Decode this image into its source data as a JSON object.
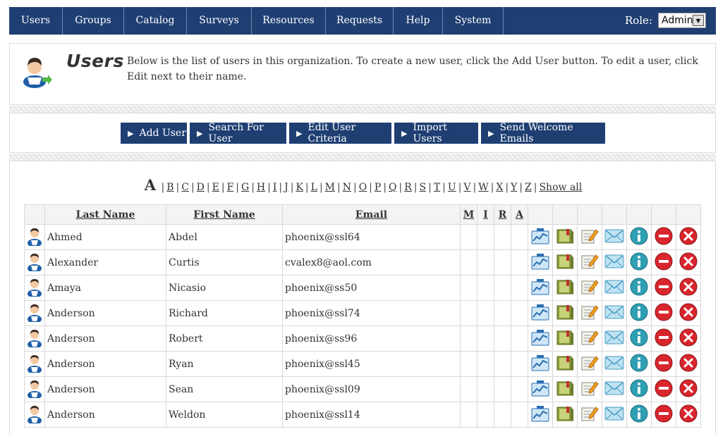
{
  "nav": {
    "items": [
      "Users",
      "Groups",
      "Catalog",
      "Surveys",
      "Resources",
      "Requests",
      "Help",
      "System"
    ],
    "role_label": "Role:",
    "role_value": "Admin"
  },
  "header": {
    "title": "Users",
    "description": "Below is the list of users in this organization. To create a new user, click the Add User button. To edit a user, click Edit next to their name."
  },
  "actions": {
    "add_user": "Add User",
    "search_user": "Search For User",
    "edit_criteria": "Edit User Criteria",
    "import_users": "Import Users",
    "send_welcome": "Send Welcome Emails"
  },
  "letters": {
    "current": "A",
    "items": [
      "B",
      "C",
      "D",
      "E",
      "F",
      "G",
      "H",
      "I",
      "J",
      "K",
      "L",
      "M",
      "N",
      "O",
      "P",
      "Q",
      "R",
      "S",
      "T",
      "U",
      "V",
      "W",
      "X",
      "Y",
      "Z"
    ],
    "show_all": "Show all"
  },
  "table": {
    "headers": {
      "last": "Last Name",
      "first": "First Name",
      "email": "Email",
      "m": "M",
      "i": "I",
      "r": "R",
      "a": "A"
    },
    "rows": [
      {
        "last": "Ahmed",
        "first": "Abdel",
        "email": "phoenix@ssl64"
      },
      {
        "last": "Alexander",
        "first": "Curtis",
        "email": "cvalex8@aol.com"
      },
      {
        "last": "Amaya",
        "first": "Nicasio",
        "email": "phoenix@ss50"
      },
      {
        "last": "Anderson",
        "first": "Richard",
        "email": "phoenix@ssl74"
      },
      {
        "last": "Anderson",
        "first": "Robert",
        "email": "phoenix@ss96"
      },
      {
        "last": "Anderson",
        "first": "Ryan",
        "email": "phoenix@ssl45"
      },
      {
        "last": "Anderson",
        "first": "Sean",
        "email": "phoenix@ssl09"
      },
      {
        "last": "Anderson",
        "first": "Weldon",
        "email": "phoenix@ssl14"
      }
    ],
    "row_icons": [
      "chart-icon",
      "book-icon",
      "edit-icon",
      "email-icon",
      "info-icon",
      "deactivate-icon",
      "delete-icon"
    ]
  },
  "colors": {
    "nav": "#1f3f73",
    "button": "#1f3f73"
  }
}
